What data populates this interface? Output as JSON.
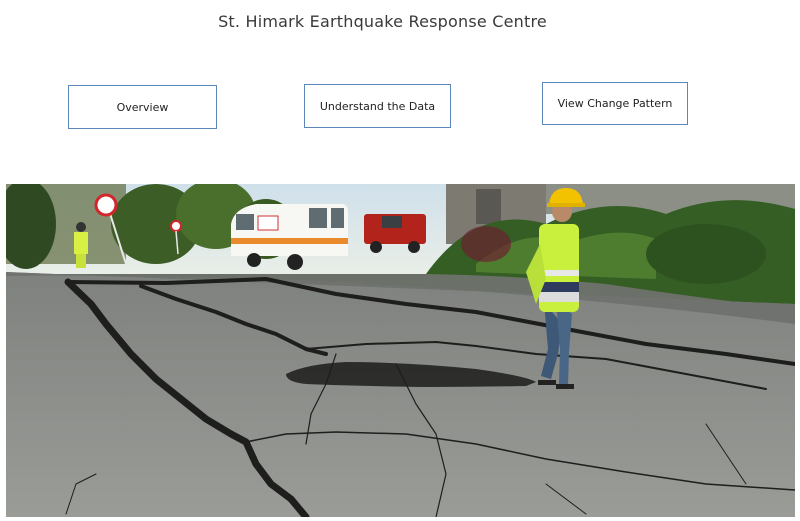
{
  "header": {
    "title": "St. Himark Earthquake Response Centre"
  },
  "nav": {
    "overview_label": "Overview",
    "understand_label": "Understand the Data",
    "change_label": "View Change Pattern"
  },
  "hero": {
    "image_subject": "cracked-road-after-earthquake-photo"
  },
  "colors": {
    "button_border": "#5b87b9",
    "title_text": "#3a3a3a",
    "asphalt": "#8d8f8c",
    "crack": "#1e1e1c",
    "worker_vest": "#c8f03c",
    "hardhat": "#f2c200",
    "ambulance_stripe": "#e98a2c",
    "fire_truck": "#b2231c"
  }
}
